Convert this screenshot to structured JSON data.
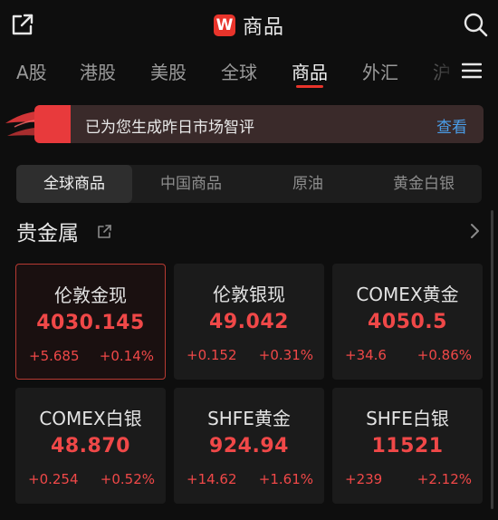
{
  "header": {
    "logo_letter": "W",
    "title": "商品"
  },
  "tabs": [
    {
      "label": "A股"
    },
    {
      "label": "港股"
    },
    {
      "label": "美股"
    },
    {
      "label": "全球"
    },
    {
      "label": "商品"
    },
    {
      "label": "外汇"
    },
    {
      "label": "沪"
    }
  ],
  "active_tab": "商品",
  "banner": {
    "message": "已为您生成昨日市场智评",
    "action": "查看"
  },
  "segments": [
    {
      "label": "全球商品"
    },
    {
      "label": "中国商品"
    },
    {
      "label": "原油"
    },
    {
      "label": "黄金白银"
    }
  ],
  "active_segment": "全球商品",
  "section": {
    "title": "贵金属"
  },
  "cards": [
    {
      "name": "伦敦金现",
      "price": "4030.145",
      "change": "+5.685",
      "percent": "+0.14%"
    },
    {
      "name": "伦敦银现",
      "price": "49.042",
      "change": "+0.152",
      "percent": "+0.31%"
    },
    {
      "name": "COMEX黄金",
      "price": "4050.5",
      "change": "+34.6",
      "percent": "+0.86%"
    },
    {
      "name": "COMEX白银",
      "price": "48.870",
      "change": "+0.254",
      "percent": "+0.52%"
    },
    {
      "name": "SHFE黄金",
      "price": "924.94",
      "change": "+14.62",
      "percent": "+1.61%"
    },
    {
      "name": "SHFE白银",
      "price": "11521",
      "change": "+239",
      "percent": "+2.12%"
    }
  ],
  "colors": {
    "accent": "#e8342b",
    "up": "#f04848",
    "link": "#4a9de8"
  },
  "icons": [
    "share-icon",
    "search-icon",
    "menu-icon",
    "external-link-icon",
    "chevron-right-icon",
    "spark-icon"
  ]
}
